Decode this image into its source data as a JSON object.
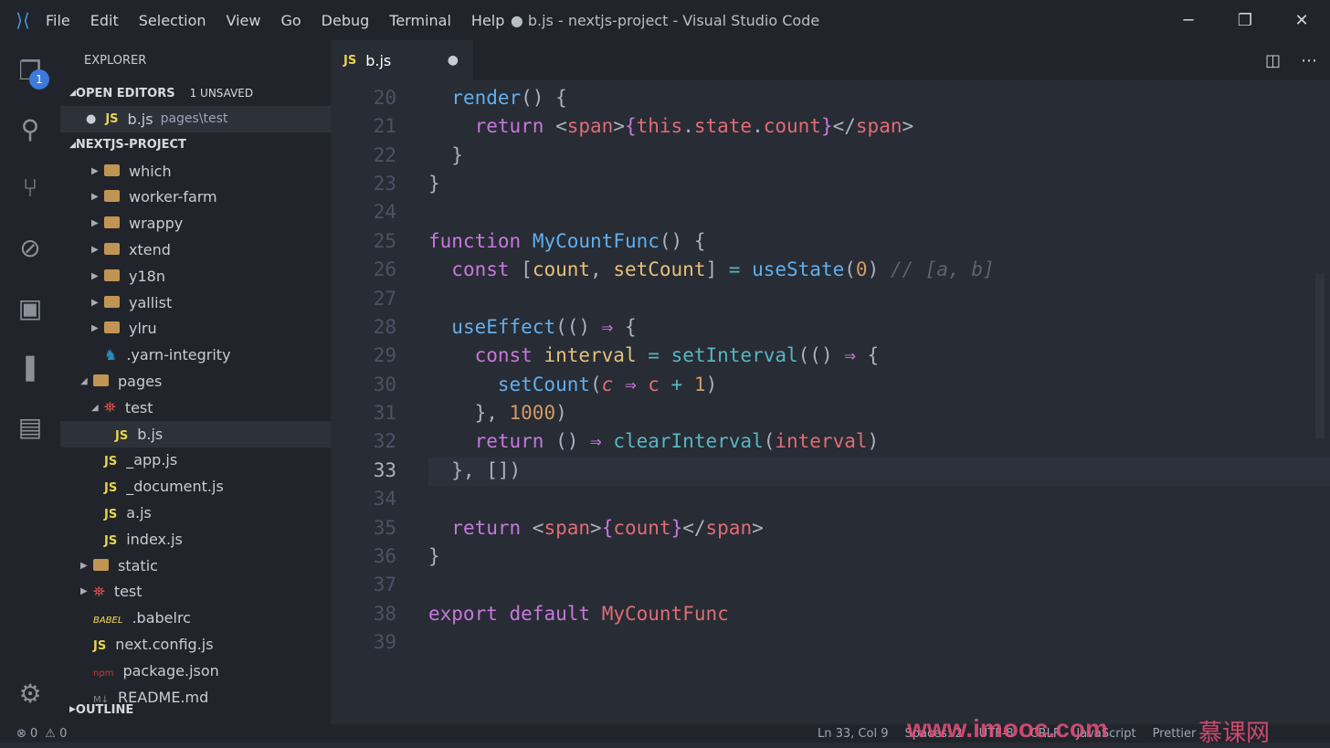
{
  "titlebar": {
    "menu": [
      "File",
      "Edit",
      "Selection",
      "View",
      "Go",
      "Debug",
      "Terminal",
      "Help"
    ],
    "title": "● b.js - nextjs-project - Visual Studio Code",
    "minimize": "─",
    "maximize": "❐",
    "close": "✕"
  },
  "activity": {
    "badge": "1",
    "icons": [
      "files-icon",
      "search-icon",
      "source-control-icon",
      "debug-icon",
      "extensions-icon",
      "bookmark-icon",
      "project-manager-icon"
    ],
    "settings": "gear-icon"
  },
  "sidebar": {
    "header": "EXPLORER",
    "open_editors": "OPEN EDITORS",
    "unsaved": "1 UNSAVED",
    "open_file": {
      "name": "b.js",
      "path": "pages\\test"
    },
    "project": "NEXTJS-PROJECT",
    "outline": "OUTLINE",
    "tree": [
      {
        "label": "which",
        "type": "folder",
        "depth": 2,
        "twisty": "▶"
      },
      {
        "label": "worker-farm",
        "type": "folder",
        "depth": 2,
        "twisty": "▶"
      },
      {
        "label": "wrappy",
        "type": "folder",
        "depth": 2,
        "twisty": "▶"
      },
      {
        "label": "xtend",
        "type": "folder",
        "depth": 2,
        "twisty": "▶"
      },
      {
        "label": "y18n",
        "type": "folder",
        "depth": 2,
        "twisty": "▶"
      },
      {
        "label": "yallist",
        "type": "folder",
        "depth": 2,
        "twisty": "▶"
      },
      {
        "label": "ylru",
        "type": "folder",
        "depth": 2,
        "twisty": "▶"
      },
      {
        "label": ".yarn-integrity",
        "type": "yarn",
        "depth": 2,
        "twisty": ""
      },
      {
        "label": "pages",
        "type": "folder",
        "depth": 1,
        "twisty": "◢"
      },
      {
        "label": "test",
        "type": "test",
        "depth": 2,
        "twisty": "◢"
      },
      {
        "label": "b.js",
        "type": "js",
        "depth": 3,
        "twisty": "",
        "selected": true
      },
      {
        "label": "_app.js",
        "type": "js",
        "depth": 2,
        "twisty": ""
      },
      {
        "label": "_document.js",
        "type": "js",
        "depth": 2,
        "twisty": ""
      },
      {
        "label": "a.js",
        "type": "js",
        "depth": 2,
        "twisty": ""
      },
      {
        "label": "index.js",
        "type": "js",
        "depth": 2,
        "twisty": ""
      },
      {
        "label": "static",
        "type": "folder",
        "depth": 1,
        "twisty": "▶"
      },
      {
        "label": "test",
        "type": "test",
        "depth": 1,
        "twisty": "▶"
      },
      {
        "label": ".babelrc",
        "type": "babel",
        "depth": 1,
        "twisty": ""
      },
      {
        "label": "next.config.js",
        "type": "js",
        "depth": 1,
        "twisty": ""
      },
      {
        "label": "package.json",
        "type": "npm",
        "depth": 1,
        "twisty": ""
      },
      {
        "label": "README.md",
        "type": "md",
        "depth": 1,
        "twisty": ""
      }
    ]
  },
  "tab": {
    "icon": "JS",
    "label": "b.js",
    "dirty": "●"
  },
  "editor": {
    "current_line": 33,
    "lines": [
      {
        "n": "20",
        "t": [
          [
            "p",
            "  "
          ],
          [
            "f",
            "render"
          ],
          [
            "p",
            "() {"
          ]
        ]
      },
      {
        "n": "21",
        "t": [
          [
            "p",
            "    "
          ],
          [
            "k",
            "return"
          ],
          [
            "p",
            " <"
          ],
          [
            "r",
            "span"
          ],
          [
            "p",
            ">"
          ],
          [
            "k",
            "{"
          ],
          [
            "r",
            "this"
          ],
          [
            "p",
            "."
          ],
          [
            "r",
            "state"
          ],
          [
            "p",
            "."
          ],
          [
            "r",
            "count"
          ],
          [
            "k",
            "}"
          ],
          [
            "p",
            "</"
          ],
          [
            "r",
            "span"
          ],
          [
            "p",
            ">"
          ]
        ]
      },
      {
        "n": "22",
        "t": [
          [
            "p",
            "  }"
          ]
        ]
      },
      {
        "n": "23",
        "t": [
          [
            "p",
            "}"
          ]
        ]
      },
      {
        "n": "24",
        "t": []
      },
      {
        "n": "25",
        "t": [
          [
            "k",
            "function"
          ],
          [
            "p",
            " "
          ],
          [
            "f",
            "MyCountFunc"
          ],
          [
            "p",
            "() {"
          ]
        ]
      },
      {
        "n": "26",
        "t": [
          [
            "p",
            "  "
          ],
          [
            "k",
            "const"
          ],
          [
            "p",
            " ["
          ],
          [
            "v",
            "count"
          ],
          [
            "p",
            ", "
          ],
          [
            "v",
            "setCount"
          ],
          [
            "p",
            "] "
          ],
          [
            "c",
            "="
          ],
          [
            "p",
            " "
          ],
          [
            "f",
            "useState"
          ],
          [
            "p",
            "("
          ],
          [
            "n",
            "0"
          ],
          [
            "p",
            ") "
          ],
          [
            "cm",
            "// [a, b]"
          ]
        ]
      },
      {
        "n": "27",
        "t": []
      },
      {
        "n": "28",
        "t": [
          [
            "p",
            "  "
          ],
          [
            "f",
            "useEffect"
          ],
          [
            "p",
            "(() "
          ],
          [
            "k",
            "⇒"
          ],
          [
            "p",
            " {"
          ]
        ]
      },
      {
        "n": "29",
        "t": [
          [
            "p",
            "    "
          ],
          [
            "k",
            "const"
          ],
          [
            "p",
            " "
          ],
          [
            "v",
            "interval"
          ],
          [
            "p",
            " "
          ],
          [
            "c",
            "="
          ],
          [
            "p",
            " "
          ],
          [
            "c",
            "setInterval"
          ],
          [
            "p",
            "(() "
          ],
          [
            "k",
            "⇒"
          ],
          [
            "p",
            " {"
          ]
        ]
      },
      {
        "n": "30",
        "t": [
          [
            "p",
            "      "
          ],
          [
            "f",
            "setCount"
          ],
          [
            "p",
            "("
          ],
          [
            "ri",
            "c"
          ],
          [
            "p",
            " "
          ],
          [
            "k",
            "⇒"
          ],
          [
            "p",
            " "
          ],
          [
            "r",
            "c"
          ],
          [
            "p",
            " "
          ],
          [
            "c",
            "+"
          ],
          [
            "p",
            " "
          ],
          [
            "n",
            "1"
          ],
          [
            "p",
            ")"
          ]
        ]
      },
      {
        "n": "31",
        "t": [
          [
            "p",
            "    }, "
          ],
          [
            "n",
            "1000"
          ],
          [
            "p",
            ")"
          ]
        ]
      },
      {
        "n": "32",
        "t": [
          [
            "p",
            "    "
          ],
          [
            "k",
            "return"
          ],
          [
            "p",
            " () "
          ],
          [
            "k",
            "⇒"
          ],
          [
            "p",
            " "
          ],
          [
            "c",
            "clearInterval"
          ],
          [
            "p",
            "("
          ],
          [
            "r",
            "interval"
          ],
          [
            "p",
            ")"
          ]
        ]
      },
      {
        "n": "33",
        "t": [
          [
            "p",
            "  }, [])"
          ]
        ]
      },
      {
        "n": "34",
        "t": []
      },
      {
        "n": "35",
        "t": [
          [
            "p",
            "  "
          ],
          [
            "k",
            "return"
          ],
          [
            "p",
            " <"
          ],
          [
            "r",
            "span"
          ],
          [
            "p",
            ">"
          ],
          [
            "k",
            "{"
          ],
          [
            "r",
            "count"
          ],
          [
            "k",
            "}"
          ],
          [
            "p",
            "</"
          ],
          [
            "r",
            "span"
          ],
          [
            "p",
            ">"
          ]
        ]
      },
      {
        "n": "36",
        "t": [
          [
            "p",
            "}"
          ]
        ]
      },
      {
        "n": "37",
        "t": []
      },
      {
        "n": "38",
        "t": [
          [
            "k",
            "export"
          ],
          [
            "p",
            " "
          ],
          [
            "k",
            "default"
          ],
          [
            "p",
            " "
          ],
          [
            "r",
            "MyCountFunc"
          ]
        ]
      },
      {
        "n": "39",
        "t": []
      }
    ]
  },
  "status": {
    "errors": "⊗ 0",
    "warnings": "⚠ 0",
    "position": "Ln 33, Col 9",
    "spaces": "Spaces: 2",
    "encoding": "UTF-8",
    "eol": "CRLF",
    "language": "JavaScript",
    "formatter": "Prettier"
  },
  "watermark": {
    "url": "www.imooc.com",
    "brand": "慕课网"
  }
}
